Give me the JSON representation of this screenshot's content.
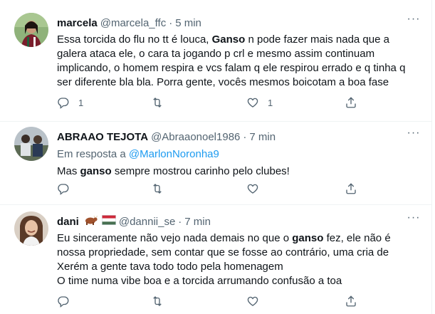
{
  "tweets": [
    {
      "name": "marcela",
      "handle": "@marcela_ffc",
      "time": "5 min",
      "text_parts": [
        "Essa torcida do flu no tt é louca, ",
        "Ganso",
        " n pode fazer mais nada que a galera ataca ele, o cara ta jogando p crl e mesmo assim continuam implicando, o homem respira e vcs falam q ele respirou errado e q tinha q ser diferente bla bla. Porra gente, vocês mesmos boicotam a boa fase"
      ],
      "reply_count": "1",
      "retweet_count": "",
      "like_count": "1"
    },
    {
      "name": "ABRAAO TEJOTA",
      "handle": "@Abraaonoel1986",
      "time": "7 min",
      "reply_to_prefix": "Em resposta a",
      "reply_to_mention": "@MarlonNoronha9",
      "text_parts": [
        "Mas ",
        "ganso",
        " sempre mostrou carinho pelo clubes!"
      ],
      "reply_count": "",
      "retweet_count": "",
      "like_count": ""
    },
    {
      "name": "dani",
      "handle": "@dannii_se",
      "time": "7 min",
      "text_parts": [
        "Eu sinceramente não vejo nada demais no que o ",
        "ganso",
        " fez, ele não é nossa propriedade, sem contar que se fosse ao contrário, uma cria de Xerém a gente tava todo todo pela homenagem",
        "O time numa vibe boa e a torcida arrumando confusão a toa"
      ],
      "reply_count": "",
      "retweet_count": "",
      "like_count": ""
    }
  ],
  "separator": "·",
  "more_label": "···",
  "icons": {
    "reply": "reply-icon",
    "retweet": "retweet-icon",
    "like": "heart-icon",
    "share": "share-icon",
    "more": "more-icon",
    "ox": "ox-emoji-icon",
    "flag": "hungary-flag-icon"
  },
  "colors": {
    "secondary_text": "#536471",
    "link": "#1d9bf0",
    "divider": "#eff3f4",
    "flag_red": "#ce2939",
    "flag_green": "#477050"
  }
}
